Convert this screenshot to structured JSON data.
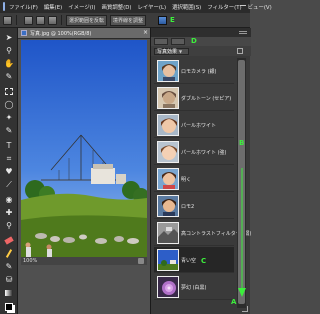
{
  "menubar": {
    "items": [
      "ファイル(F)",
      "編集(E)",
      "イメージ(I)",
      "画質調整(D)",
      "レイヤー(L)",
      "選択範囲(S)",
      "フィルター(T)",
      "ビュー(V)"
    ]
  },
  "options_bar": {
    "button1": "選択範囲を反転",
    "button2": "境界線を調整",
    "marker_e": "E"
  },
  "document": {
    "tab_title": "写真.jpg @ 100%(RGB/8)",
    "close": "×",
    "zoom": "100%"
  },
  "panel": {
    "marker_d": "D",
    "filter_value": "写真効果",
    "marker_b": "B",
    "marker_c": "C",
    "marker_a": "A",
    "items": [
      {
        "label": "ロモカメラ (銀)"
      },
      {
        "label": "ダブルトーン (セピア)"
      },
      {
        "label": "パールホワイト"
      },
      {
        "label": "パールホワイト (強)"
      },
      {
        "label": "明く"
      },
      {
        "label": "ロモ2"
      },
      {
        "label": "高コントラストフィルター (弱)"
      },
      {
        "label": "青い空"
      },
      {
        "label": "夢幻 (白黒)"
      }
    ]
  },
  "colors": {
    "marker_green": "#3cf03c",
    "selected_row": "#262626"
  }
}
